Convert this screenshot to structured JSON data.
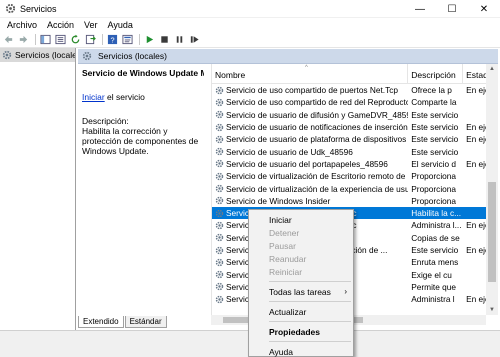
{
  "window": {
    "title": "Servicios",
    "minimize_label": "—",
    "maximize_label": "☐",
    "close_label": "✕"
  },
  "menu": [
    "Archivo",
    "Acción",
    "Ver",
    "Ayuda"
  ],
  "tree": {
    "root_label": "Servicios (locales)"
  },
  "pane_header": "Servicios (locales)",
  "description": {
    "service_title": "Servicio de Windows Update Medic",
    "start_link": "Iniciar",
    "start_suffix": " el servicio",
    "desc_label": "Descripción:",
    "desc_text": "Habilita la corrección y protección de componentes de Windows Update."
  },
  "columns": {
    "name": "Nombre",
    "description": "Descripción",
    "state": "Estad"
  },
  "rows": [
    {
      "name": "Servicio de uso compartido de puertos Net.Tcp",
      "desc": "Ofrece la p",
      "state": "En eje"
    },
    {
      "name": "Servicio de uso compartido de red del Reproductor de ...",
      "desc": "Comparte la",
      "state": ""
    },
    {
      "name": "Servicio de usuario de difusión y GameDVR_48596",
      "desc": "Este servicio",
      "state": ""
    },
    {
      "name": "Servicio de usuario de notificaciones de inserción de ...",
      "desc": "Este servicio",
      "state": "En eje"
    },
    {
      "name": "Servicio de usuario de plataforma de dispositivos con...",
      "desc": "Este servicio",
      "state": "En eje"
    },
    {
      "name": "Servicio de usuario de Udk_48596",
      "desc": "Este servicio",
      "state": ""
    },
    {
      "name": "Servicio de usuario del portapapeles_48596",
      "desc": "El servicio d",
      "state": "En eje"
    },
    {
      "name": "Servicio de virtualización de Escritorio remoto de Hyp...",
      "desc": "Proporciona",
      "state": ""
    },
    {
      "name": "Servicio de virtualización de la experiencia de usuario",
      "desc": "Proporciona",
      "state": ""
    },
    {
      "name": "Servicio de Windows Insider",
      "desc": "Proporciona",
      "state": ""
    },
    {
      "name": "Servicio de Windows Update Medic",
      "desc": "Habilita la c...",
      "state": ""
    },
    {
      "name": "Servicio de Windows Update Medic",
      "desc": "Administra l...",
      "state": "En eje"
    },
    {
      "name": "Servicio de seguridad a nivel de ...",
      "desc": "Copias de se",
      "state": ""
    },
    {
      "name": "Servicio de notificaciones de inserción de ...",
      "desc": "Este servicio",
      "state": "En eje"
    },
    {
      "name": "Servicio de Windows",
      "desc": "Enruta mens",
      "state": ""
    },
    {
      "name": "Servicio de ...rtables",
      "desc": "Exige el cu",
      "state": ""
    },
    {
      "name": "Servicio de Windows",
      "desc": "Permite que",
      "state": ""
    },
    {
      "name": "Servicio de ...ft Office",
      "desc": "Administra l",
      "state": "En eje"
    }
  ],
  "tabs": [
    "Extendido",
    "Estándar"
  ],
  "context_menu": {
    "items": [
      {
        "label": "Iniciar",
        "disabled": false
      },
      {
        "label": "Detener",
        "disabled": true
      },
      {
        "label": "Pausar",
        "disabled": true
      },
      {
        "label": "Reanudar",
        "disabled": true
      },
      {
        "label": "Reiniciar",
        "disabled": true
      },
      {
        "label": "Todas las tareas",
        "disabled": false,
        "submenu": true
      },
      {
        "label": "Actualizar",
        "disabled": false
      },
      {
        "label": "Propiedades",
        "disabled": false,
        "bold": true
      },
      {
        "label": "Ayuda",
        "disabled": false
      }
    ],
    "submenu_arrow": "›"
  },
  "colors": {
    "selection": "#0078d7",
    "header_band": "#cdd9ea",
    "link": "#0033cc"
  }
}
